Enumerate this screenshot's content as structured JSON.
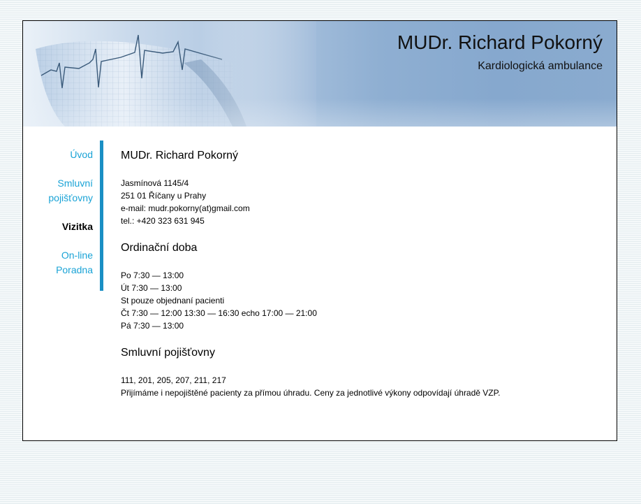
{
  "header": {
    "title": "MUDr. Richard Pokorný",
    "subtitle": "Kardiologická ambulance"
  },
  "nav": {
    "items": [
      {
        "line1": "Úvod",
        "line2": ""
      },
      {
        "line1": "Smluvní",
        "line2": "pojišťovny"
      },
      {
        "line1": "Vizitka",
        "line2": ""
      },
      {
        "line1": "On-line",
        "line2": "Poradna"
      }
    ],
    "active": "Vizitka"
  },
  "contact": {
    "heading": "MUDr. Richard Pokorný",
    "street": "Jasmínová 1145/4",
    "city": "251 01 Říčany u Prahy",
    "email": "e-mail: mudr.pokorny(at)gmail.com",
    "phone": "tel.: +420 323 631 945"
  },
  "hours": {
    "heading": "Ordinační doba",
    "lines": [
      "Po 7:30 — 13:00",
      "Út 7:30 — 13:00",
      "St pouze objednaní pacienti",
      "Čt 7:30 — 12:00 13:30 — 16:30 echo 17:00 — 21:00",
      "Pá 7:30 — 13:00"
    ]
  },
  "insurance": {
    "heading": "Smluvní pojišťovny",
    "codes": "111, 201, 205, 207, 211, 217",
    "note": "Přijímáme i nepojištěné pacienty za přímou úhradu. Ceny za jednotlivé výkony odpovídají úhradě VZP."
  },
  "colors": {
    "accent": "#1a8fc4",
    "link": "#1aa3d6"
  }
}
